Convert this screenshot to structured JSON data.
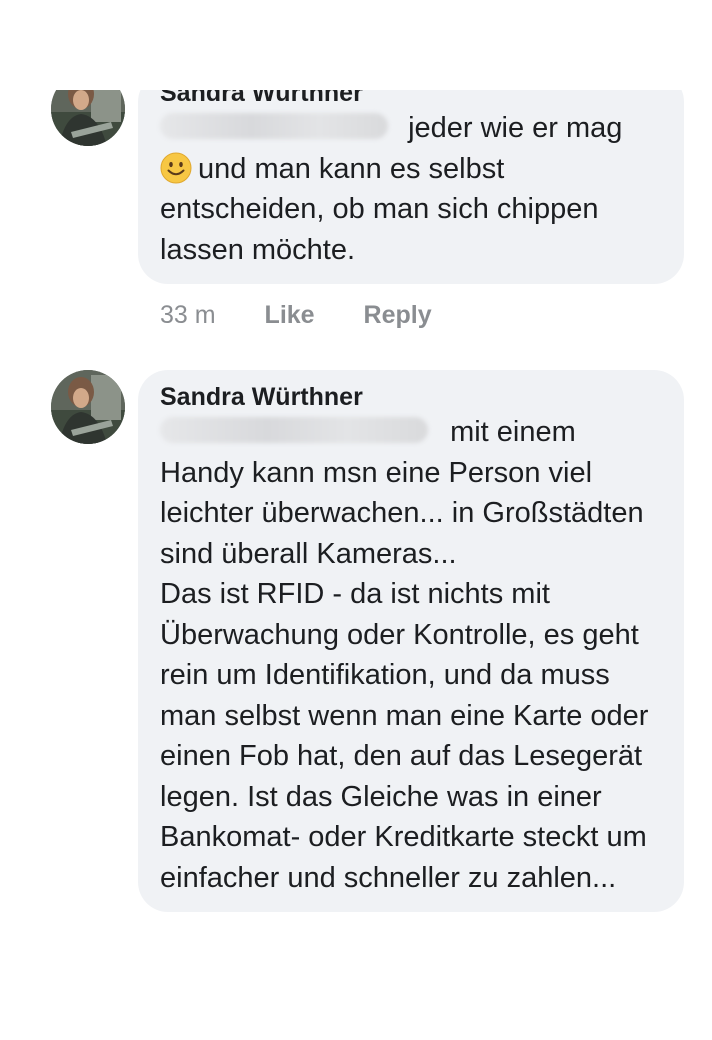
{
  "comments": [
    {
      "author": "Sandra Würthner",
      "text_first_line_after_redaction": "jeder wie er mag",
      "text_rest": "und man kann es selbst entscheiden, ob man sich chippen lassen möchte.",
      "emoji": "slightly-smiling-face",
      "time": "33 m",
      "like_label": "Like",
      "reply_label": "Reply"
    },
    {
      "author": "Sandra Würthner",
      "text_first_line_after_redaction": "mit einem",
      "text_rest": "Handy kann msn eine Person viel leichter überwachen... in Großstädten sind überall Kameras...",
      "text_paragraph_2": "Das ist RFID - da ist nichts mit Überwachung oder Kontrolle, es geht rein um Identifikation, und da muss man selbst wenn man eine Karte oder einen Fob hat, den auf das Lesegerät legen. Ist das Gleiche was in einer Bankomat- oder Kreditkarte steckt um einfacher und schneller zu zahlen..."
    }
  ],
  "colors": {
    "bubble": "#f0f2f5",
    "text": "#1c1e21",
    "meta": "#8a8d91"
  }
}
